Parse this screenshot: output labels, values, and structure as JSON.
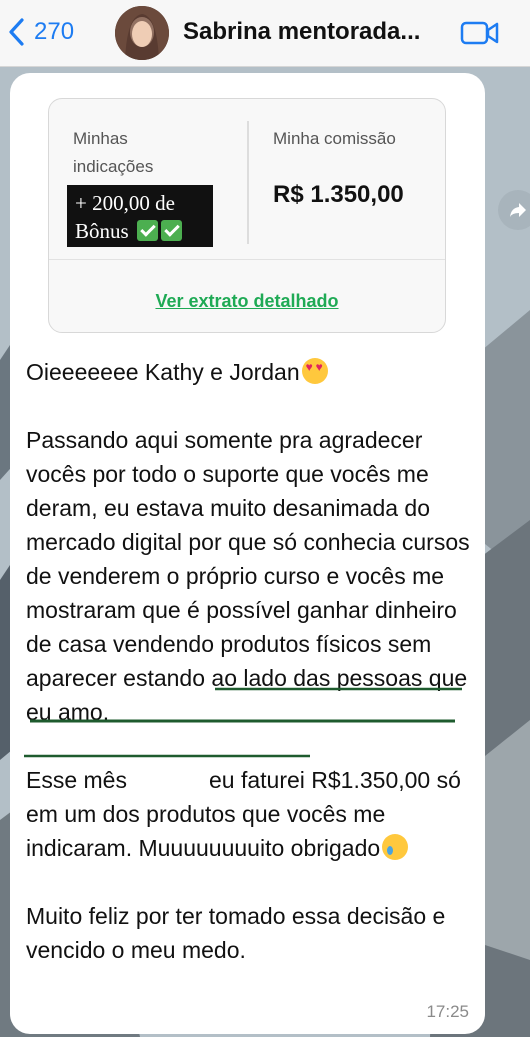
{
  "header": {
    "back_count": "270",
    "contact_name": "Sabrina mentorada..."
  },
  "card": {
    "referrals_label_line1": "Minhas",
    "referrals_label_line2": "indicações",
    "bonus_line1": "+ 200,00 de",
    "bonus_line2": "Bônus",
    "commission_label": "Minha comissão",
    "commission_value": "R$ 1.350,00",
    "statement_link": "Ver extrato detalhado"
  },
  "message": {
    "greeting": "Oieeeeeee Kathy e Jordan",
    "paragraph1": "Passando aqui somente pra agradecer vocês por todo o suporte que vocês me deram, eu estava muito desanimada do mercado digital por que só conhecia cursos de venderem o próprio curso e vocês me mostraram que é possível ganhar dinheiro de casa vendendo produtos físicos sem aparecer estando ao lado das pessoas que eu amo.",
    "p2_part1": "Esse mês",
    "p2_part2": "eu faturei R$1.350,00 só em um dos produtos que vocês me indicaram. Muuuuuuuuito obrigado",
    "paragraph3": "Muito feliz por ter tomado essa decisão e vencido o meu medo.",
    "time": "17:25"
  },
  "icons": {
    "back": "chevron-left-icon",
    "video": "video-camera-icon",
    "forward": "forward-arrow-icon",
    "check": "check-mark-icon",
    "emoji_heart": "heart-eyes-emoji",
    "emoji_cry": "crying-emoji"
  },
  "colors": {
    "accent_blue": "#1d7cf2",
    "link_green": "#1faa55",
    "highlight_line": "#1e5b2e"
  }
}
